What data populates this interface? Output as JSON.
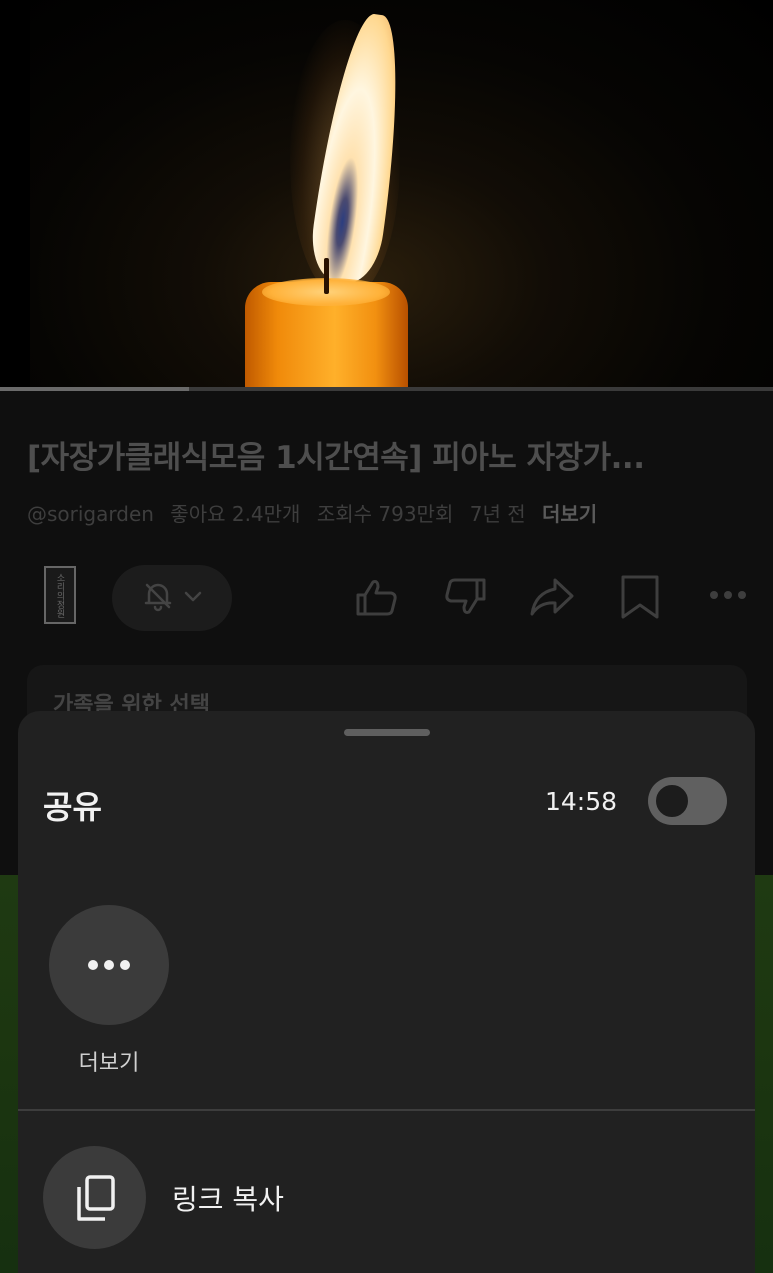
{
  "video": {
    "progress_percent": 24.5
  },
  "details": {
    "title": "[자장가클래식모음 1시간연속] 피아노 자장가...",
    "channel": "@sorigarden",
    "likes": "좋아요 2.4만개",
    "views": "조회수 793만회",
    "age": "7년 전",
    "more_label": "더보기"
  },
  "channel_logo_text": "소리의정원",
  "description_card": {
    "text": "가족을 위한 선택"
  },
  "share_sheet": {
    "title": "공유",
    "start_time": "14:58",
    "more_label": "더보기",
    "copy_link_label": "링크 복사"
  },
  "colors": {
    "background": "#0f0f0f",
    "sheet": "#212121",
    "circle": "#3b3b3b"
  },
  "icons": [
    "bell-off-icon",
    "chevron-down-icon",
    "like-icon",
    "dislike-icon",
    "share-icon",
    "save-icon",
    "more-horizontal-icon",
    "copy-icon"
  ]
}
